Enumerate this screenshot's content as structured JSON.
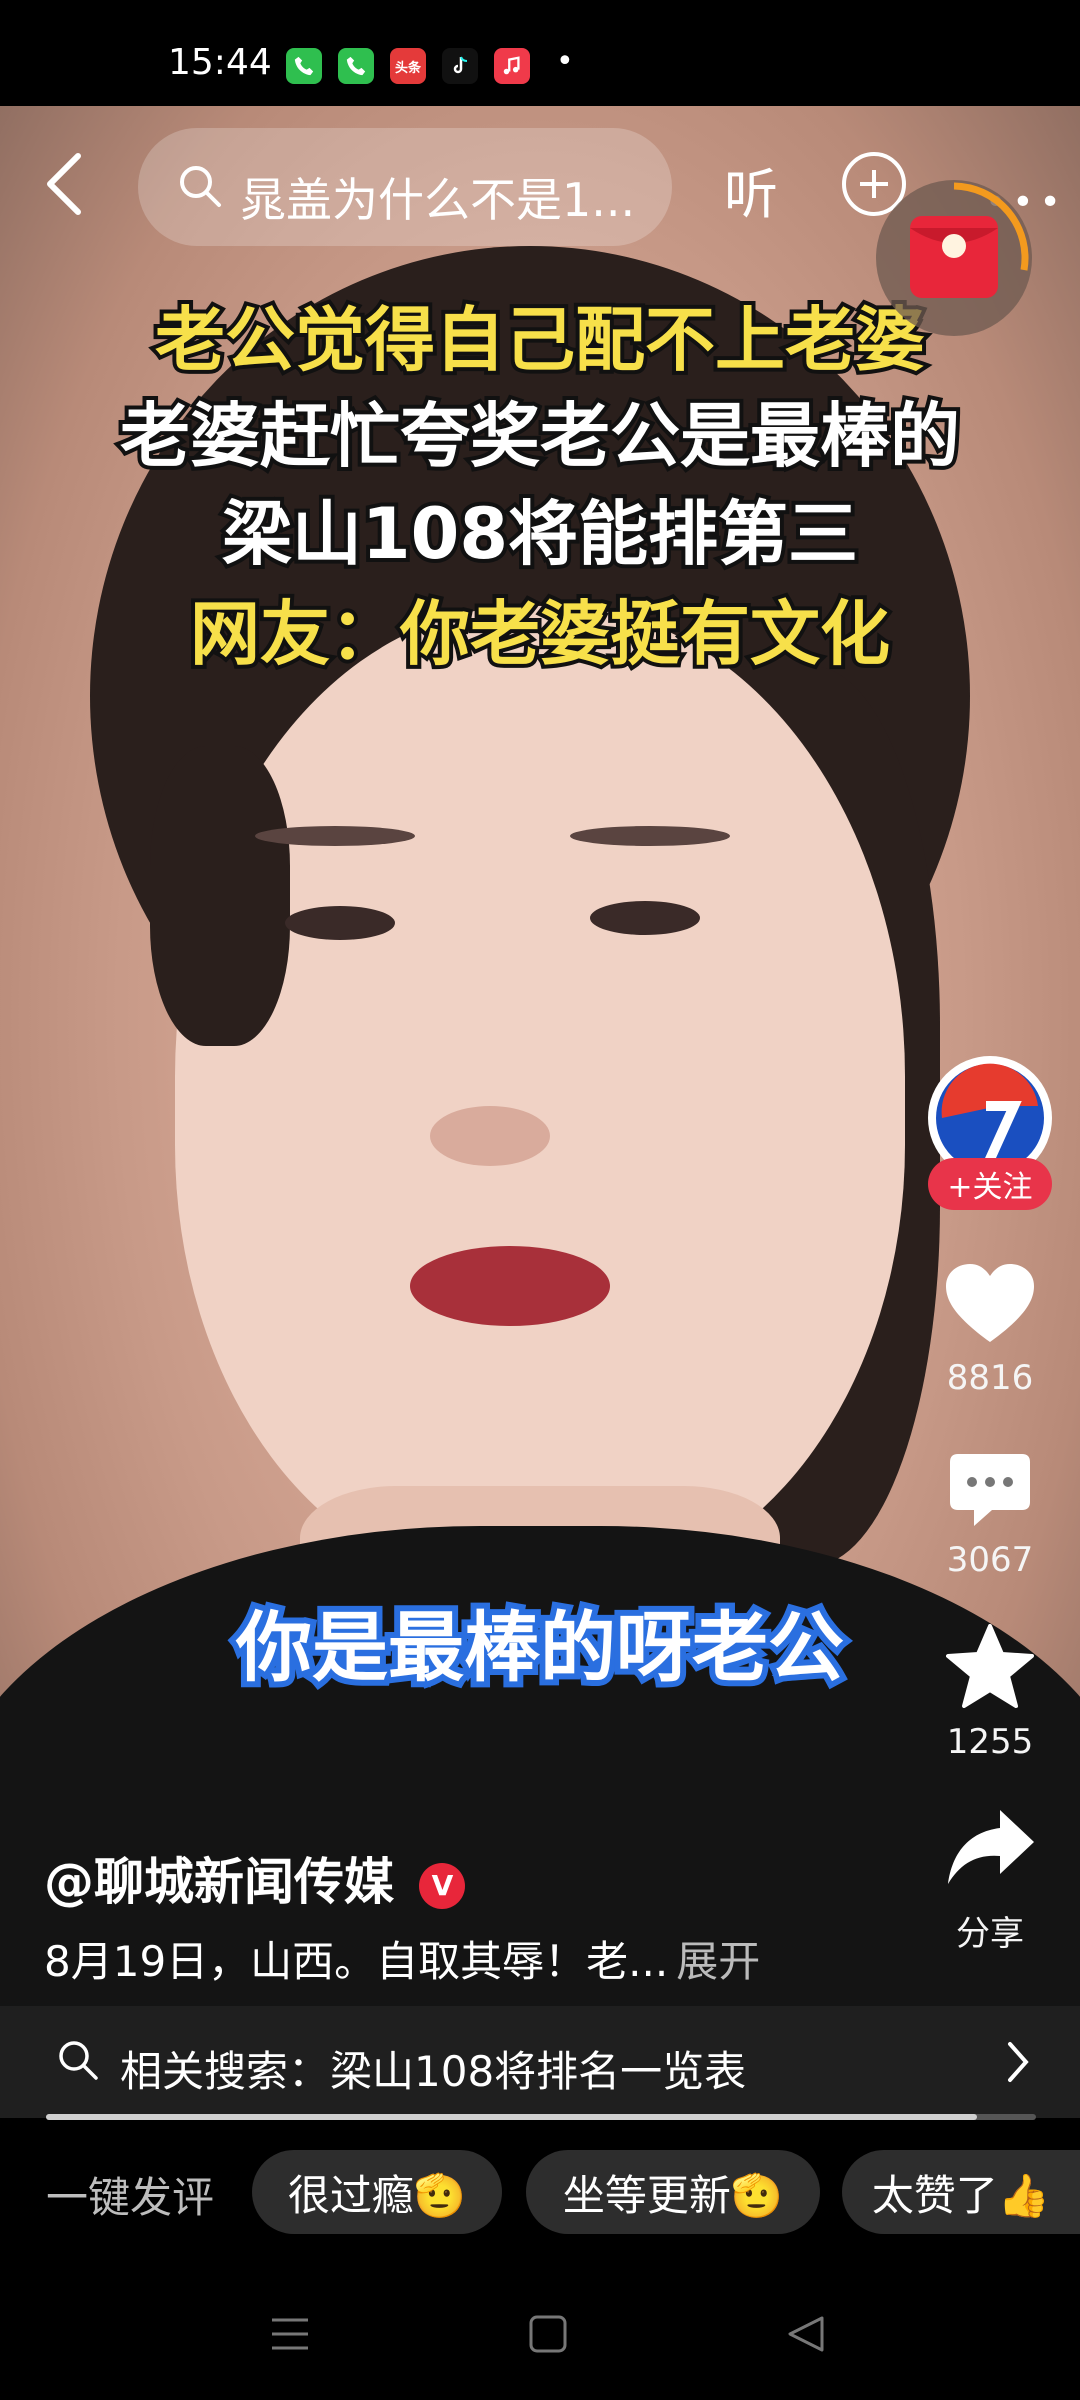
{
  "status_bar": {
    "time": "15:44",
    "icons": [
      "phone-icon",
      "phone-icon",
      "toutiao-icon",
      "tiktok-icon",
      "music-icon"
    ],
    "dot": "•"
  },
  "top_bar": {
    "search_text": "晁盖为什么不是1...",
    "listen_label": "听"
  },
  "captions": {
    "line1": "老公觉得自己配不上老婆",
    "line2": "老婆赶忙夸奖老公是最棒的",
    "line3": "梁山108将能排第三",
    "line4": "网友：你老婆挺有文化",
    "subtitle": "你是最棒的呀老公"
  },
  "side": {
    "follow_label": "+关注",
    "likes": "8816",
    "comments": "3067",
    "favorites": "1255",
    "share_label": "分享"
  },
  "info": {
    "username": "@聊城新闻传媒",
    "verified": "V",
    "description": "8月19日，山西。自取其辱！老...",
    "expand_label": "展开"
  },
  "related": {
    "text": "相关搜索：梁山108将排名一览表"
  },
  "quick_comment": {
    "label": "一键发评",
    "chips": [
      "很过瘾🫡",
      "坐等更新🫡",
      "太赞了👍"
    ]
  },
  "colors": {
    "caption_yellow": "#f7e04a",
    "caption_blue": "#2a6fe0",
    "follow_red": "#e8344a"
  },
  "progress": 0.94
}
